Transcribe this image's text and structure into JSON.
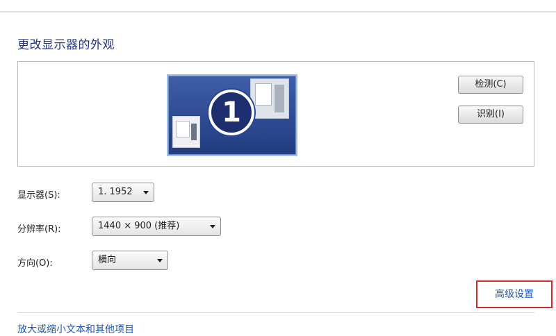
{
  "page": {
    "title": "更改显示器的外观"
  },
  "preview": {
    "monitor_number": "1",
    "detect_label": "检测(C)",
    "identify_label": "识别(I)"
  },
  "settings": {
    "display": {
      "label": "显示器(S):",
      "value": "1. 1952"
    },
    "resolution": {
      "label": "分辨率(R):",
      "value": "1440 × 900 (推荐)"
    },
    "orientation": {
      "label": "方向(O):",
      "value": "横向"
    }
  },
  "links": {
    "advanced": "高级设置",
    "bottom": "放大或缩小文本和其他项目"
  },
  "colors": {
    "title": "#1e3287",
    "link": "#1f58b6",
    "highlight_box": "#c9302c",
    "monitor_bg": "#2e4a92"
  },
  "icons": {
    "dropdown": "chevron-down-icon",
    "monitor": "monitor-icon"
  }
}
